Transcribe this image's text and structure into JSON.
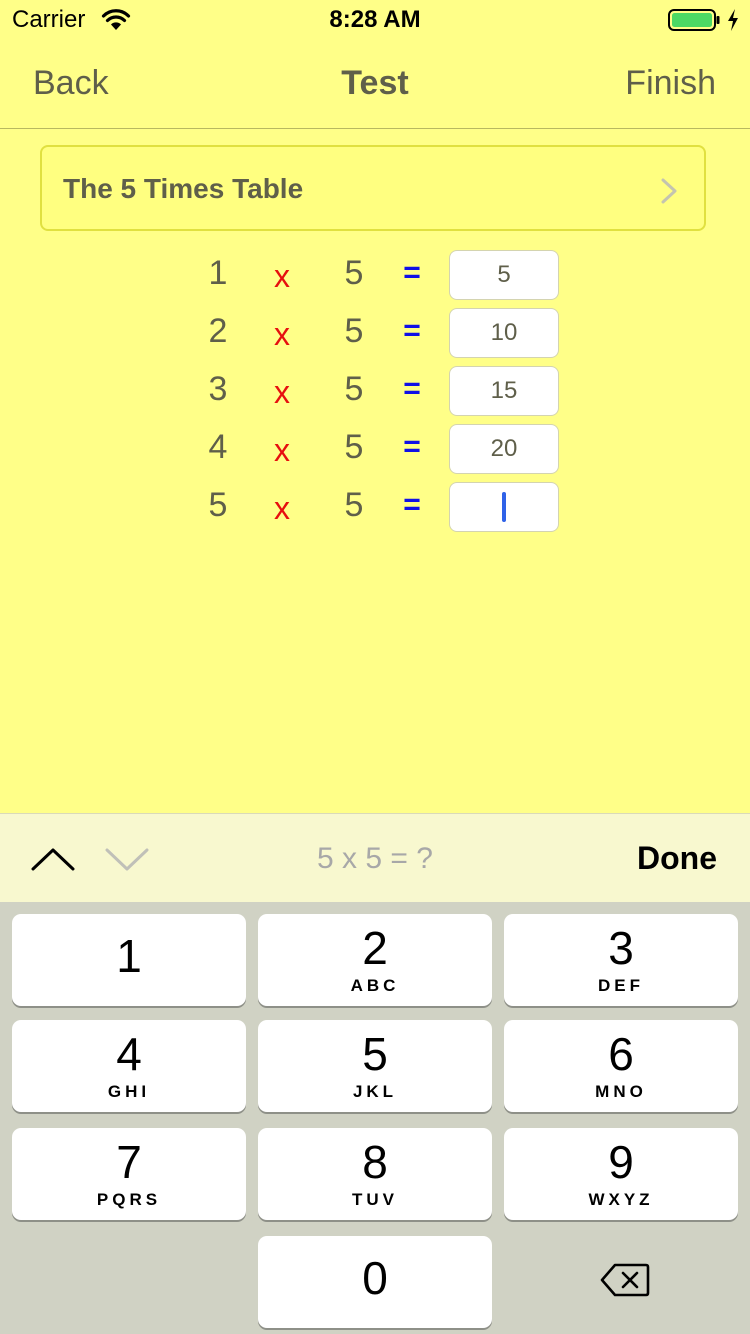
{
  "status_bar": {
    "carrier": "Carrier",
    "time": "8:28 AM",
    "wifi_icon": "wifi-icon",
    "battery_icon": "battery-icon",
    "charging_icon": "charging-bolt-icon",
    "battery_color": "#4CD964"
  },
  "nav": {
    "back_label": "Back",
    "title": "Test",
    "finish_label": "Finish"
  },
  "table_selector": {
    "label": "The 5 Times Table",
    "icon": "chevron-right-icon"
  },
  "equations": [
    {
      "a": "1",
      "op": "x",
      "b": "5",
      "eq": "=",
      "answer": "5"
    },
    {
      "a": "2",
      "op": "x",
      "b": "5",
      "eq": "=",
      "answer": "10"
    },
    {
      "a": "3",
      "op": "x",
      "b": "5",
      "eq": "=",
      "answer": "15"
    },
    {
      "a": "4",
      "op": "x",
      "b": "5",
      "eq": "=",
      "answer": "20"
    },
    {
      "a": "5",
      "op": "x",
      "b": "5",
      "eq": "=",
      "answer": ""
    }
  ],
  "accessory": {
    "prev_icon": "chevron-up-icon",
    "next_icon": "chevron-down-icon",
    "prompt": "5 x 5 = ?",
    "done_label": "Done"
  },
  "keypad": {
    "keys": [
      {
        "digit": "1",
        "letters": ""
      },
      {
        "digit": "2",
        "letters": "ABC"
      },
      {
        "digit": "3",
        "letters": "DEF"
      },
      {
        "digit": "4",
        "letters": "GHI"
      },
      {
        "digit": "5",
        "letters": "JKL"
      },
      {
        "digit": "6",
        "letters": "MNO"
      },
      {
        "digit": "7",
        "letters": "PQRS"
      },
      {
        "digit": "8",
        "letters": "TUV"
      },
      {
        "digit": "9",
        "letters": "WXYZ"
      },
      {
        "digit": "0",
        "letters": ""
      }
    ],
    "delete_icon": "backspace-icon"
  },
  "colors": {
    "background": "#FFFF88",
    "multiply_sign": "#E6100F",
    "equals_sign": "#1010E6",
    "cursor": "#2F62E8"
  }
}
